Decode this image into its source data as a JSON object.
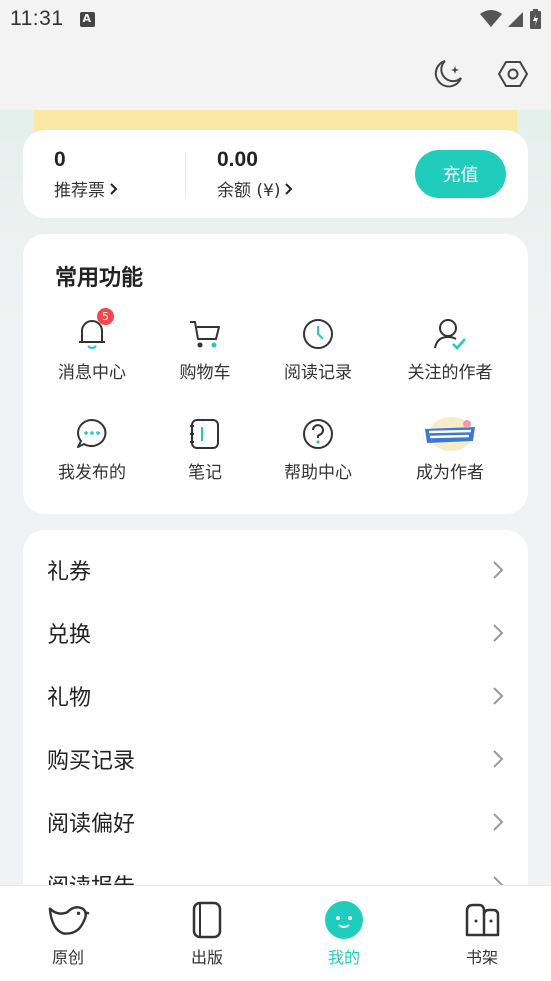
{
  "status_bar": {
    "time": "11:31"
  },
  "balance": {
    "votes_value": "0",
    "votes_label": "推荐票",
    "balance_value": "0.00",
    "balance_label": "余额 (¥)",
    "recharge_label": "充值"
  },
  "functions": {
    "title": "常用功能",
    "items": [
      {
        "label": "消息中心",
        "icon": "bell-icon",
        "badge": "5"
      },
      {
        "label": "购物车",
        "icon": "cart-icon"
      },
      {
        "label": "阅读记录",
        "icon": "clock-icon"
      },
      {
        "label": "关注的作者",
        "icon": "user-check-icon"
      },
      {
        "label": "我发布的",
        "icon": "chat-bubble-icon"
      },
      {
        "label": "笔记",
        "icon": "notebook-icon"
      },
      {
        "label": "帮助中心",
        "icon": "help-icon"
      },
      {
        "label": "成为作者",
        "icon": "author-badge-icon"
      }
    ]
  },
  "menu": {
    "items": [
      {
        "label": "礼券"
      },
      {
        "label": "兑换"
      },
      {
        "label": "礼物"
      },
      {
        "label": "购买记录"
      },
      {
        "label": "阅读偏好"
      },
      {
        "label": "阅读报告"
      }
    ]
  },
  "bottom_nav": {
    "items": [
      {
        "label": "原创",
        "icon": "bird-icon"
      },
      {
        "label": "出版",
        "icon": "book-icon"
      },
      {
        "label": "我的",
        "icon": "smile-face-icon",
        "active": true
      },
      {
        "label": "书架",
        "icon": "bookshelf-icon"
      }
    ]
  },
  "colors": {
    "accent": "#20cdbd",
    "badge": "#f0484b",
    "banner": "#fbe8a6"
  }
}
